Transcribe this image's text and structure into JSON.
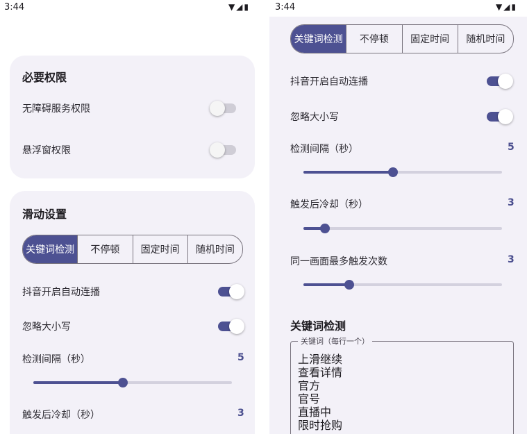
{
  "left": {
    "status": {
      "time": "3:44",
      "icons": "▼◢▮"
    },
    "permissions": {
      "title": "必要权限",
      "items": [
        {
          "label": "无障碍服务权限",
          "on": false
        },
        {
          "label": "悬浮窗权限",
          "on": false
        }
      ]
    },
    "swipe": {
      "title": "滑动设置",
      "modes": [
        "关键词检测",
        "不停顿",
        "固定时间",
        "随机时间"
      ],
      "selected_mode": 0,
      "toggles": [
        {
          "label": "抖音开启自动连播",
          "on": true
        },
        {
          "label": "忽略大小写",
          "on": true
        }
      ],
      "sliders": [
        {
          "label": "检测间隔（秒）",
          "value": "5",
          "fraction": 0.45
        },
        {
          "label": "触发后冷却（秒）",
          "value": "3"
        }
      ]
    }
  },
  "right": {
    "status": {
      "time": "3:44",
      "icons": "▼◢▮"
    },
    "modes": [
      "关键词检测",
      "不停顿",
      "固定时间",
      "随机时间"
    ],
    "selected_mode": 0,
    "toggles": [
      {
        "label": "抖音开启自动连播",
        "on": true
      },
      {
        "label": "忽略大小写",
        "on": true
      }
    ],
    "sliders": [
      {
        "label": "检测间隔（秒）",
        "value": "5",
        "fraction": 0.45
      },
      {
        "label": "触发后冷却（秒）",
        "value": "3",
        "fraction": 0.11
      },
      {
        "label": "同一画面最多触发次数",
        "value": "3",
        "fraction": 0.23
      }
    ],
    "keyword_section": {
      "title": "关键词检测",
      "field_label": "关键词（每行一个）",
      "keywords": [
        "上滑继续",
        "查看详情",
        "官方",
        "官号",
        "直播中",
        "限时抢购"
      ]
    }
  },
  "colors": {
    "accent": "#4d5192",
    "card": "#f3f1f8",
    "track": "#d3d1de",
    "value": "#4a4e8e"
  }
}
